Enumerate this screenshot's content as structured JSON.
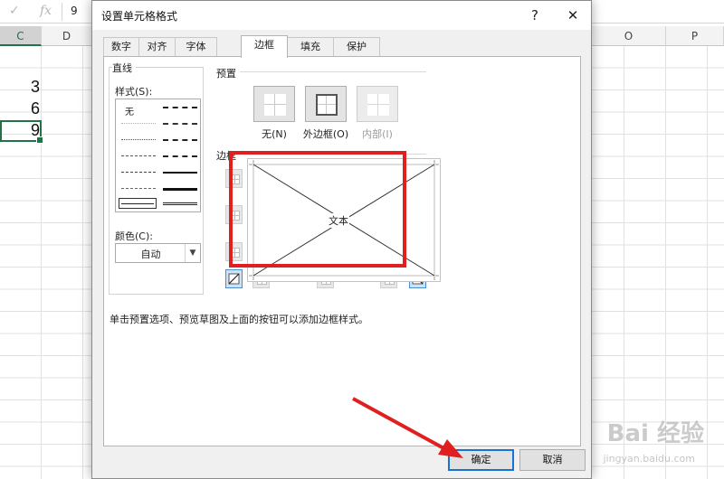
{
  "formula_bar": {
    "cancel_icon": "✓",
    "fx": "fx",
    "value": "9"
  },
  "columns": {
    "c": "C",
    "d": "D",
    "o": "O",
    "p": "P"
  },
  "cells": [
    "3",
    "6",
    "9"
  ],
  "dialog": {
    "title": "设置单元格格式",
    "help": "?",
    "close": "✕",
    "tabs": [
      "数字",
      "对齐",
      "字体",
      "边框",
      "填充",
      "保护"
    ],
    "active_tab": "边框",
    "line_group": "直线",
    "style_label": "样式(S):",
    "style_none": "无",
    "color_label": "颜色(C):",
    "color_value": "自动",
    "presets_label": "预置",
    "presets": [
      {
        "label": "无(N)",
        "enabled": true
      },
      {
        "label": "外边框(O)",
        "enabled": true
      },
      {
        "label": "内部(I)",
        "enabled": false
      }
    ],
    "border_label": "边框",
    "preview_text": "文本",
    "hint": "单击预置选项、预览草图及上面的按钮可以添加边框样式。",
    "ok": "确定",
    "cancel": "取消"
  },
  "watermark": {
    "brand": "Bai  经验",
    "url": "jingyan.baidu.com"
  },
  "colors": {
    "accent": "#217346",
    "highlight": "#e02020",
    "default_button": "#1a73d1"
  }
}
